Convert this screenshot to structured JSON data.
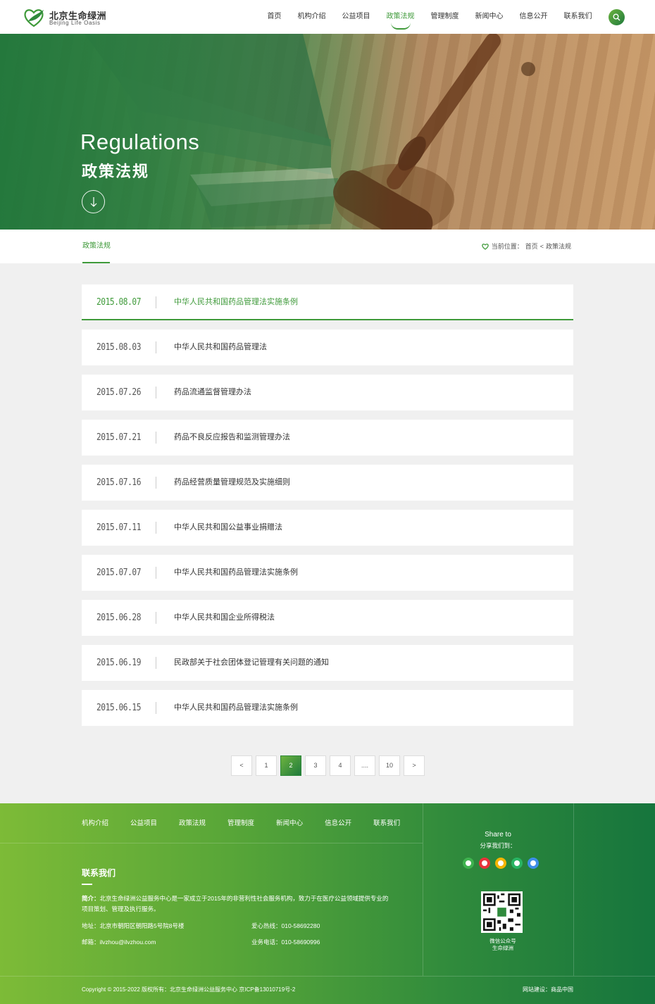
{
  "logo": {
    "cn": "北京生命绿洲",
    "en": "Beijing Life Oasis",
    "icon": "heart-leaf-logo-icon"
  },
  "nav": [
    {
      "label": "首页",
      "active": false
    },
    {
      "label": "机构介绍",
      "active": false
    },
    {
      "label": "公益项目",
      "active": false
    },
    {
      "label": "政策法规",
      "active": true
    },
    {
      "label": "管理制度",
      "active": false
    },
    {
      "label": "新闻中心",
      "active": false
    },
    {
      "label": "信息公开",
      "active": false
    },
    {
      "label": "联系我们",
      "active": false
    }
  ],
  "search_icon": "search-icon",
  "banner": {
    "en": "Regulations",
    "cn": "政策法规",
    "down_icon": "arrow-down-icon"
  },
  "subbar": {
    "tab": "政策法规",
    "crumb_prefix": "当前位置：",
    "crumb_home": "首页",
    "crumb_sep": "<",
    "crumb_current": "政策法规"
  },
  "articles": [
    {
      "date": "2015.08.07",
      "title": "中华人民共和国药品管理法实施条例",
      "active": true
    },
    {
      "date": "2015.08.03",
      "title": "中华人民共和国药品管理法",
      "active": false
    },
    {
      "date": "2015.07.26",
      "title": "药品流通监督管理办法",
      "active": false
    },
    {
      "date": "2015.07.21",
      "title": "药品不良反应报告和监测管理办法",
      "active": false
    },
    {
      "date": "2015.07.16",
      "title": "药品经营质量管理规范及实施细则",
      "active": false
    },
    {
      "date": "2015.07.11",
      "title": "中华人民共和国公益事业捐赠法",
      "active": false
    },
    {
      "date": "2015.07.07",
      "title": "中华人民共和国药品管理法实施条例",
      "active": false
    },
    {
      "date": "2015.06.28",
      "title": "中华人民共和国企业所得税法",
      "active": false
    },
    {
      "date": "2015.06.19",
      "title": "民政部关于社会团体登记管理有关问题的通知",
      "active": false
    },
    {
      "date": "2015.06.15",
      "title": "中华人民共和国药品管理法实施条例",
      "active": false
    }
  ],
  "pagination": {
    "prev": "<",
    "pages": [
      "1",
      "2",
      "3",
      "4",
      "....",
      "10"
    ],
    "current": "2",
    "next": ">"
  },
  "footer": {
    "nav": [
      "机构介绍",
      "公益项目",
      "政策法规",
      "管理制度",
      "新闻中心",
      "信息公开",
      "联系我们"
    ],
    "contact_title": "联系我们",
    "intro_label": "简介：",
    "intro_text": "北京生命绿洲公益服务中心是一家成立于2015年的非营利性社会服务机构，致力于在医疗公益领域提供专业的项目策划、管理及执行服务。",
    "address": "地址：北京市朝阳区朝阳路5号院8号楼",
    "email": "邮箱：ilvzhou@ilvzhou.com",
    "hotline": "爱心热线：010-58692280",
    "phone": "业务电话：010-58690996",
    "share_en": "Share to",
    "share_cn": "分享我们到：",
    "share_icons": [
      {
        "name": "wechat-icon",
        "color": "#3fb34f"
      },
      {
        "name": "weibo-icon",
        "color": "#e6333a"
      },
      {
        "name": "qzone-icon",
        "color": "#f5b400"
      },
      {
        "name": "moments-icon",
        "color": "#28b463"
      },
      {
        "name": "qq-icon",
        "color": "#3d8ee8"
      }
    ],
    "qr_label_1": "微信公众号",
    "qr_label_2": "生命绿洲",
    "copyright": "Copyright © 2015-2022  版权所有：北京生命绿洲公益服务中心  京ICP备13010719号-2",
    "credit": "网站建设：商品中国"
  },
  "colors": {
    "accent": "#3f9a3a",
    "footer_start": "#7dbb37",
    "footer_end": "#16753d"
  }
}
